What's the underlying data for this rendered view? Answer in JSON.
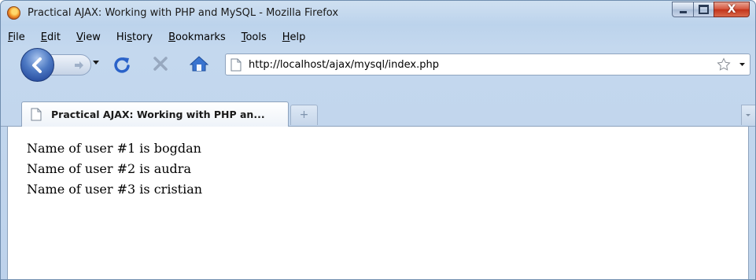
{
  "window": {
    "title": "Practical AJAX: Working with PHP and MySQL - Mozilla Firefox",
    "close_glyph": "X"
  },
  "menubar": {
    "items": [
      {
        "accel": "F",
        "rest": "ile"
      },
      {
        "accel": "E",
        "rest": "dit"
      },
      {
        "accel": "V",
        "rest": "iew"
      },
      {
        "pre": "Hi",
        "accel": "s",
        "rest": "tory"
      },
      {
        "accel": "B",
        "rest": "ookmarks"
      },
      {
        "accel": "T",
        "rest": "ools"
      },
      {
        "accel": "H",
        "rest": "elp"
      }
    ]
  },
  "navbar": {
    "url": "http://localhost/ajax/mysql/index.php",
    "icons": [
      "back-icon",
      "forward-icon",
      "history-dropdown-icon",
      "reload-icon",
      "stop-icon",
      "home-icon",
      "page-icon",
      "bookmark-star-icon",
      "url-dropdown-icon"
    ]
  },
  "tabs": {
    "active_title": "Practical AJAX: Working with PHP an...",
    "new_tab_glyph": "+"
  },
  "content": {
    "lines": [
      "Name of user #1 is bogdan",
      "Name of user #2 is audra",
      "Name of user #3 is cristian"
    ]
  },
  "colors": {
    "chrome": "#c4d8ee",
    "close_button": "#c2331a",
    "back_button": "#4d79c3",
    "reload_icon": "#2a62c9"
  }
}
